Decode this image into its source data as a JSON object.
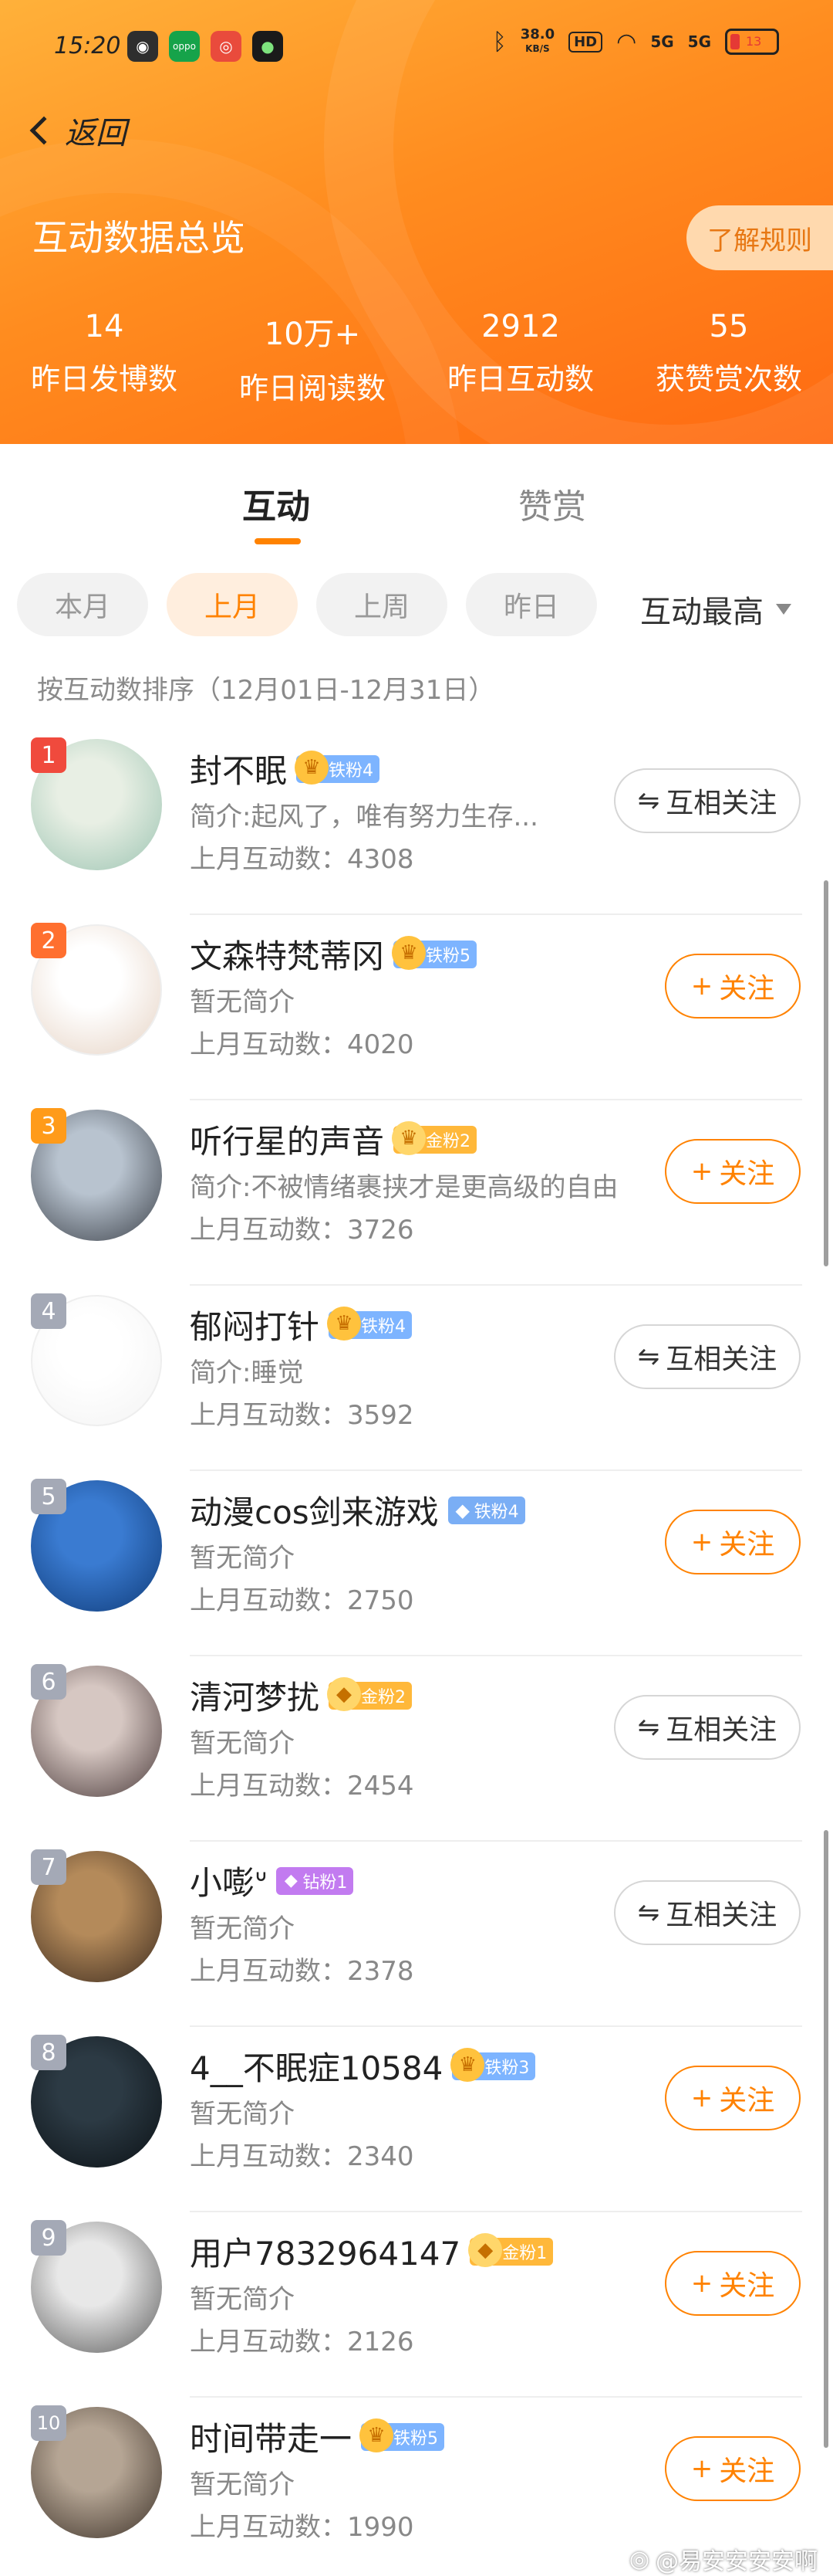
{
  "status_bar": {
    "time": "15:20",
    "net_speed_value": "38.0",
    "net_speed_unit": "KB/S",
    "hd_label": "HD",
    "signal1": "5G",
    "signal2": "5G",
    "battery_level": "13"
  },
  "header": {
    "back_label": "返回",
    "title": "互动数据总览",
    "rules_label": "了解规则",
    "stats": [
      {
        "value": "14",
        "label": "昨日发博数"
      },
      {
        "value": "10万+",
        "label": "昨日阅读数"
      },
      {
        "value": "2912",
        "label": "昨日互动数"
      },
      {
        "value": "55",
        "label": "获赞赏次数"
      }
    ]
  },
  "tabs": [
    {
      "label": "互动",
      "active": true
    },
    {
      "label": "赞赏",
      "active": false
    }
  ],
  "filters": [
    {
      "label": "本月",
      "active": false
    },
    {
      "label": "上月",
      "active": true
    },
    {
      "label": "上周",
      "active": false
    },
    {
      "label": "昨日",
      "active": false
    }
  ],
  "sort_label": "互动最高",
  "range_caption": "按互动数排序（12月01日-12月31日）",
  "count_prefix": "上月互动数：",
  "users": [
    {
      "rank": "1",
      "rank_color": "#f04a3d",
      "name": "封不眠",
      "badge_type": "iron",
      "badge_text": "铁粉4",
      "badge_icon": "♛",
      "intro": "简介:起风了，唯有努力生存...",
      "count": "4308",
      "button": "互相关注",
      "button_type": "mutual",
      "avatar_colors": [
        "#e8efe4",
        "#9cc4b2"
      ]
    },
    {
      "rank": "2",
      "rank_color": "#ff6f2f",
      "name": "文森特梵蒂冈",
      "badge_type": "iron",
      "badge_text": "铁粉5",
      "badge_icon": "♛",
      "intro": "暂无简介",
      "count": "4020",
      "button": "关注",
      "button_type": "follow",
      "avatar_colors": [
        "#ffffff",
        "#e6d3c4"
      ]
    },
    {
      "rank": "3",
      "rank_color": "#ff9b1a",
      "name": "听行星的声音",
      "badge_type": "gold",
      "badge_text": "金粉2",
      "badge_icon": "♛",
      "intro": "简介:不被情绪裹挟才是更高级的自由",
      "count": "3726",
      "button": "关注",
      "button_type": "follow",
      "avatar_colors": [
        "#b8c3cf",
        "#3b4048"
      ]
    },
    {
      "rank": "4",
      "rank_color": "#a4a9b6",
      "name": "郁闷打针",
      "badge_type": "iron",
      "badge_text": "铁粉4",
      "badge_icon": "♛",
      "intro": "简介:睡觉",
      "count": "3592",
      "button": "互相关注",
      "button_type": "mutual",
      "avatar_colors": [
        "#ffffff",
        "#f3f3f3"
      ]
    },
    {
      "rank": "5",
      "rank_color": "#a4a9b6",
      "name": "动漫cos剑来游戏",
      "badge_type": "diamond",
      "badge_text": "铁粉4",
      "badge_icon": "◆",
      "intro": "暂无简介",
      "count": "2750",
      "button": "关注",
      "button_type": "follow",
      "avatar_colors": [
        "#3a7bd1",
        "#0f3b78"
      ]
    },
    {
      "rank": "6",
      "rank_color": "#a4a9b6",
      "name": "清河梦扰",
      "badge_type": "gold",
      "badge_text": "金粉2",
      "badge_icon": "◆",
      "intro": "暂无简介",
      "count": "2454",
      "button": "互相关注",
      "button_type": "mutual",
      "avatar_colors": [
        "#d6c7c2",
        "#4a3a3a"
      ]
    },
    {
      "rank": "7",
      "rank_color": "#a4a9b6",
      "name": "小嘭ᐡ",
      "badge_type": "drill",
      "badge_text": "钻粉1",
      "badge_icon": "◆",
      "intro": "暂无简介",
      "count": "2378",
      "button": "互相关注",
      "button_type": "mutual",
      "avatar_colors": [
        "#b48a5a",
        "#3b2a1e"
      ]
    },
    {
      "rank": "8",
      "rank_color": "#a4a9b6",
      "name": "4__不眠症10584",
      "badge_type": "iron",
      "badge_text": "铁粉3",
      "badge_icon": "♛",
      "intro": "暂无简介",
      "count": "2340",
      "button": "关注",
      "button_type": "follow",
      "avatar_colors": [
        "#2c3a44",
        "#0b1115"
      ]
    },
    {
      "rank": "9",
      "rank_color": "#a4a9b6",
      "name": "用户7832964147",
      "badge_type": "gold",
      "badge_text": "金粉1",
      "badge_icon": "◆",
      "intro": "暂无简介",
      "count": "2126",
      "button": "关注",
      "button_type": "follow",
      "avatar_colors": [
        "#e8e8e8",
        "#5a5a5a"
      ]
    },
    {
      "rank": "10",
      "rank_color": "#a4a9b6",
      "name": "时间带走一",
      "badge_type": "iron",
      "badge_text": "铁粉5",
      "badge_icon": "♛",
      "intro": "暂无简介",
      "count": "1990",
      "button": "关注",
      "button_type": "follow",
      "avatar_colors": [
        "#b5a594",
        "#3c3128"
      ]
    }
  ],
  "watermark": "@易安安安安啊"
}
